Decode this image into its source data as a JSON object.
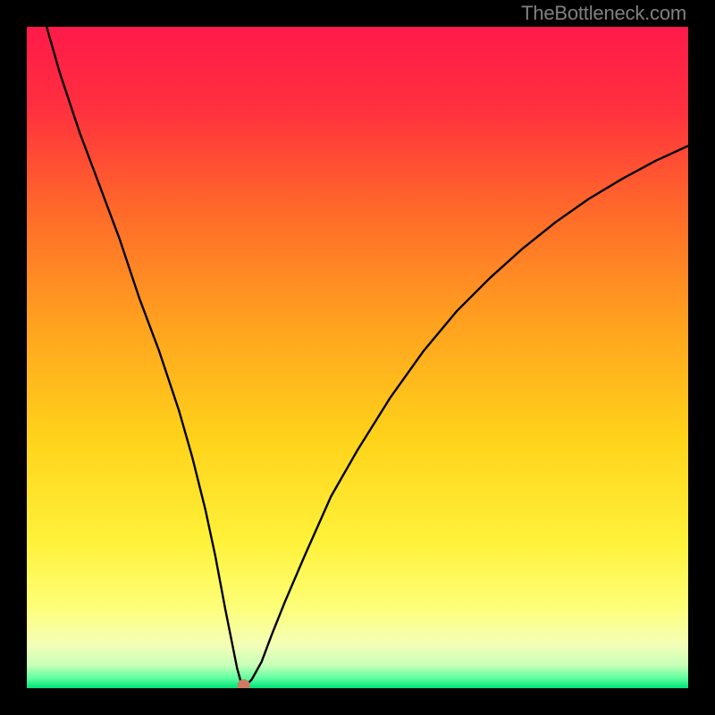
{
  "watermark": "TheBottleneck.com",
  "chart_data": {
    "type": "line",
    "title": "",
    "xlabel": "",
    "ylabel": "",
    "xlim": [
      0,
      100
    ],
    "ylim": [
      0,
      100
    ],
    "grid": false,
    "legend": false,
    "background_gradient": {
      "stops": [
        {
          "offset": 0.0,
          "color": "#ff1a4a"
        },
        {
          "offset": 0.12,
          "color": "#ff2f3f"
        },
        {
          "offset": 0.28,
          "color": "#ff6a2a"
        },
        {
          "offset": 0.45,
          "color": "#ffa21f"
        },
        {
          "offset": 0.62,
          "color": "#ffd21a"
        },
        {
          "offset": 0.78,
          "color": "#fff23a"
        },
        {
          "offset": 0.88,
          "color": "#fdff7a"
        },
        {
          "offset": 0.935,
          "color": "#f3ffb8"
        },
        {
          "offset": 0.965,
          "color": "#c8ffb8"
        },
        {
          "offset": 0.985,
          "color": "#5effa0"
        },
        {
          "offset": 1.0,
          "color": "#00e078"
        }
      ]
    },
    "series": [
      {
        "name": "bottleneck-curve",
        "color": "#000000",
        "x": [
          3,
          5,
          8,
          11,
          14,
          17,
          20,
          23,
          25,
          27,
          28.5,
          30,
          31,
          31.8,
          32.3,
          32.6,
          33.2,
          34,
          35.5,
          37,
          39,
          42,
          46,
          50,
          55,
          60,
          65,
          70,
          75,
          80,
          85,
          90,
          95,
          100
        ],
        "y": [
          100,
          93,
          84,
          76,
          68,
          59,
          51,
          42,
          35,
          27,
          20,
          12,
          7,
          3,
          1.2,
          0.5,
          0.5,
          1.3,
          4,
          8,
          13,
          20,
          29,
          36,
          44,
          51,
          57,
          62,
          66.5,
          70.5,
          74,
          77,
          79.7,
          82
        ]
      }
    ],
    "marker": {
      "x": 32.8,
      "y": 0.4,
      "color": "#d07a63",
      "radius_px": 7
    }
  }
}
